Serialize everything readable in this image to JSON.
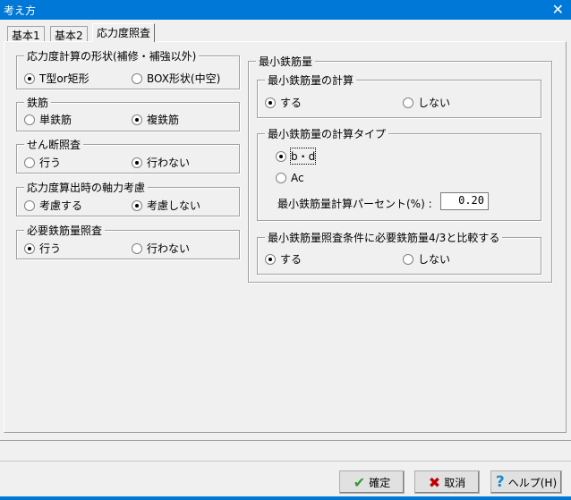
{
  "window": {
    "title": "考え方",
    "close": "✕"
  },
  "tabs": [
    {
      "label": "基本1"
    },
    {
      "label": "基本2"
    },
    {
      "label": "応力度照査"
    }
  ],
  "left": {
    "shape": {
      "label": "応力度計算の形状(補修・補強以外)",
      "options": [
        "T型or矩形",
        "BOX形状(中空)"
      ],
      "selected": 0
    },
    "rebar": {
      "label": "鉄筋",
      "options": [
        "単鉄筋",
        "複鉄筋"
      ],
      "selected": 1
    },
    "shear": {
      "label": "せん断照査",
      "options": [
        "行う",
        "行わない"
      ],
      "selected": 1
    },
    "axial": {
      "label": "応力度算出時の軸力考慮",
      "options": [
        "考慮する",
        "考慮しない"
      ],
      "selected": 1
    },
    "required": {
      "label": "必要鉄筋量照査",
      "options": [
        "行う",
        "行わない"
      ],
      "selected": 0
    }
  },
  "right": {
    "label": "最小鉄筋量",
    "calc": {
      "label": "最小鉄筋量の計算",
      "options": [
        "する",
        "しない"
      ],
      "selected": 0
    },
    "type": {
      "label": "最小鉄筋量の計算タイプ",
      "options": [
        "b・d",
        "Ac"
      ],
      "selected": 0,
      "percent_label": "最小鉄筋量計算パーセント(%) :",
      "percent_value": "0.20"
    },
    "compare": {
      "label": "最小鉄筋量照査条件に必要鉄筋量4/3と比較する",
      "options": [
        "する",
        "しない"
      ],
      "selected": 0
    }
  },
  "buttons": {
    "ok": "確定",
    "cancel": "取消",
    "help": "ヘルプ(H)"
  },
  "colors": {
    "titlebar": "#0078d7",
    "ok_icon": "#2e9e2e",
    "cancel_icon": "#c00000",
    "help_icon": "#1a8fc8"
  }
}
